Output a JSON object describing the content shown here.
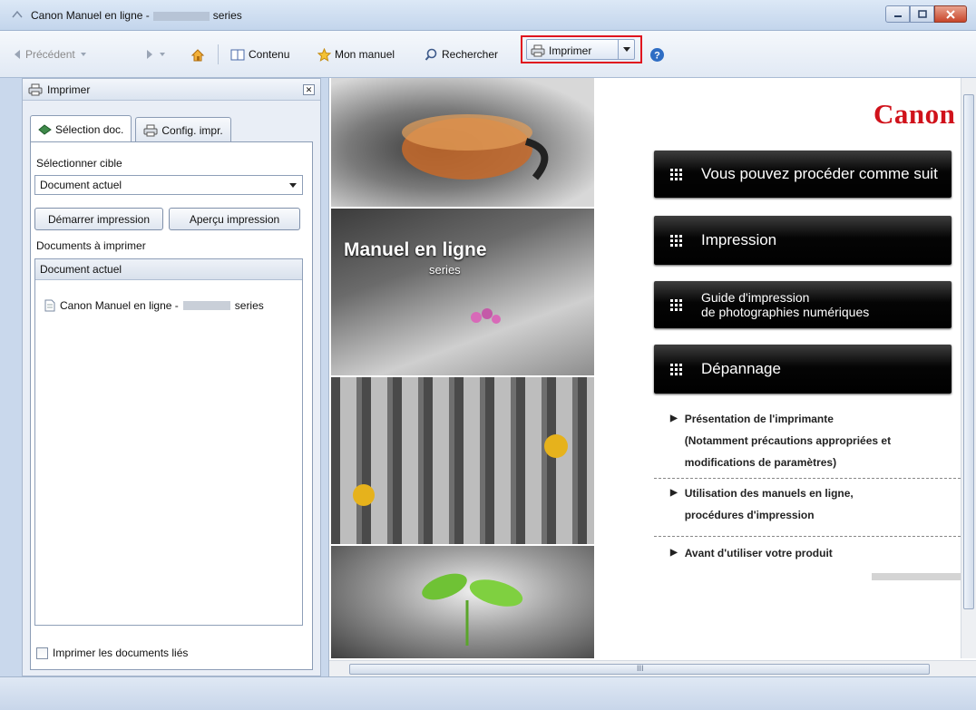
{
  "window": {
    "title_prefix": "Canon Manuel en ligne -",
    "title_suffix": "series"
  },
  "toolbar": {
    "back_label": "Précédent",
    "contents_label": "Contenu",
    "my_manual_label": "Mon manuel",
    "search_label": "Rechercher",
    "print_label": "Imprimer"
  },
  "left_pane": {
    "title": "Imprimer",
    "tabs": [
      {
        "label": "Sélection doc."
      },
      {
        "label": "Config. impr."
      }
    ],
    "target_label": "Sélectionner cible",
    "target_value": "Document actuel",
    "start_print_label": "Démarrer impression",
    "preview_label": "Aperçu impression",
    "docs_label": "Documents à imprimer",
    "list_header": "Document actuel",
    "doc_prefix": "Canon Manuel en ligne -",
    "doc_suffix": "series",
    "print_linked_label": "Imprimer les documents liés"
  },
  "content": {
    "logo": "Canon",
    "banner_title": "Manuel en ligne",
    "banner_sub": "series",
    "menu": [
      {
        "label": "Vous pouvez procéder comme suit"
      },
      {
        "label": "Impression"
      },
      {
        "label_1": "Guide d'impression",
        "label_2": "de photographies numériques"
      },
      {
        "label": "Dépannage"
      }
    ],
    "links": [
      {
        "line_1": "Présentation de l'imprimante",
        "line_2": "(Notamment précautions appropriées et",
        "line_3": "modifications de paramètres)"
      },
      {
        "line_1": "Utilisation des manuels en ligne,",
        "line_2": "procédures d'impression"
      },
      {
        "line_1": "Avant d'utiliser votre produit"
      }
    ],
    "hscroll_mark": "III"
  },
  "colors": {
    "accent_red": "#d0121b",
    "highlight_red": "#e0141e",
    "menu_black": "#000000"
  }
}
